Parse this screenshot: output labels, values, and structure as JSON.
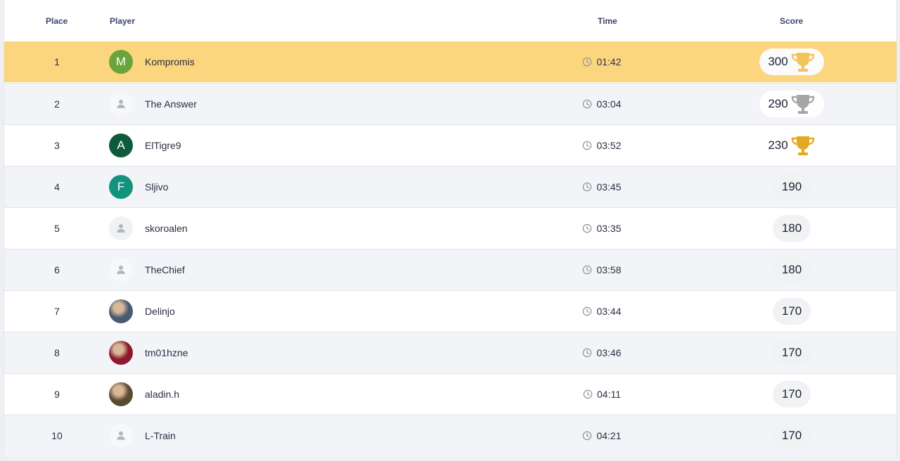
{
  "columns": {
    "place": "Place",
    "player": "Player",
    "time": "Time",
    "score": "Score"
  },
  "colors": {
    "first_row_bg": "#fcd67f",
    "trophy_first": "#f3c35c",
    "trophy_second": "#a6a6a6",
    "trophy_third": "#e4a823"
  },
  "rows": [
    {
      "place": "1",
      "player": "Kompromis",
      "time": "01:42",
      "score": "300",
      "avatar": {
        "type": "letter",
        "letter": "M",
        "color": "#6aa43a"
      },
      "trophy": "gold-trophy-icon"
    },
    {
      "place": "2",
      "player": "The Answer",
      "time": "03:04",
      "score": "290",
      "avatar": {
        "type": "default"
      },
      "trophy": "silver-trophy-icon"
    },
    {
      "place": "3",
      "player": "ElTigre9",
      "time": "03:52",
      "score": "230",
      "avatar": {
        "type": "letter",
        "letter": "A",
        "color": "#0d5a3d"
      },
      "trophy": "bronze-trophy-icon"
    },
    {
      "place": "4",
      "player": "Sljivo",
      "time": "03:45",
      "score": "190",
      "avatar": {
        "type": "letter",
        "letter": "F",
        "color": "#12937e"
      }
    },
    {
      "place": "5",
      "player": "skoroalen",
      "time": "03:35",
      "score": "180",
      "avatar": {
        "type": "default"
      }
    },
    {
      "place": "6",
      "player": "TheChief",
      "time": "03:58",
      "score": "180",
      "avatar": {
        "type": "default"
      }
    },
    {
      "place": "7",
      "player": "Delinjo",
      "time": "03:44",
      "score": "170",
      "avatar": {
        "type": "photo",
        "color": "#4a5a72"
      }
    },
    {
      "place": "8",
      "player": "tm01hzne",
      "time": "03:46",
      "score": "170",
      "avatar": {
        "type": "photo",
        "color": "#8c1a2c"
      }
    },
    {
      "place": "9",
      "player": "aladin.h",
      "time": "04:11",
      "score": "170",
      "avatar": {
        "type": "photo",
        "color": "#5a4a30"
      }
    },
    {
      "place": "10",
      "player": "L-Train",
      "time": "04:21",
      "score": "170",
      "avatar": {
        "type": "default"
      }
    }
  ]
}
